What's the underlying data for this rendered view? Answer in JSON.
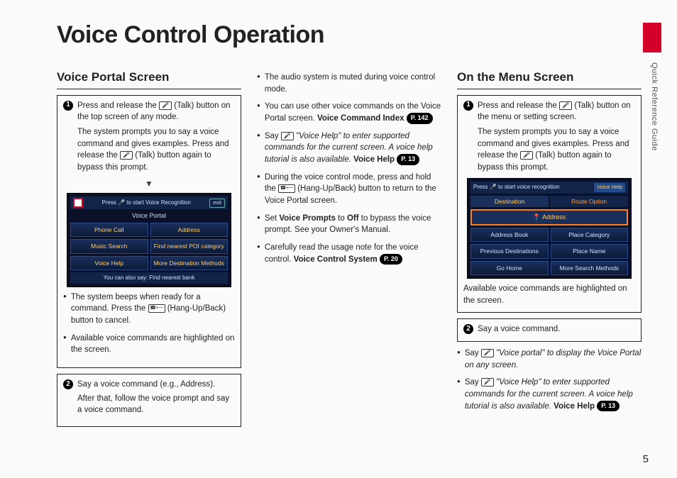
{
  "page_title": "Voice Control Operation",
  "side_label": "Quick Reference Guide",
  "page_number": "5",
  "col1": {
    "heading": "Voice Portal Screen",
    "step1a": "Press and release the ",
    "step1b": " (Talk) button on the top screen of any mode.",
    "step1c": "The system prompts you to say a voice command and gives examples. Press and release the ",
    "step1d": " (Talk) button again to bypass this prompt.",
    "bullet_a1": "The system beeps when ready for a command. Press the ",
    "bullet_a2": " (Hang-Up/Back) button to cancel.",
    "bullet_b": "Available voice commands are highlighted on the screen.",
    "step2a": "Say a voice command (e.g., Address).",
    "step2b": "After that, follow the voice prompt and say a voice command."
  },
  "mock1": {
    "bar_text": "Press 🎤 to start Voice Recognition",
    "exit": "exit",
    "title": "Voice Portal",
    "buttons": [
      "Phone Call",
      "Address",
      "Music Search",
      "Find nearest POI category",
      "Voice Help",
      "More Destination Methods"
    ],
    "footer": "You can also say: Find nearest bank"
  },
  "col2": {
    "b1": "The audio system is muted during voice control mode.",
    "b2a": "You can use other voice commands on the Voice Portal screen. ",
    "b2b": "Voice Command Index",
    "p2": "P. 142",
    "b3a": "Say ",
    "b3b": " \"Voice Help\" to enter supported commands for the current screen. A voice help tutorial is also available. ",
    "b3c": "Voice Help",
    "p3": "P. 13",
    "b4a": "During the voice control mode, press and hold the ",
    "b4b": " (Hang-Up/Back) button to return to the Voice Portal screen.",
    "b5a": "Set ",
    "b5b": "Voice Prompts",
    "b5c": " to ",
    "b5d": "Off",
    "b5e": " to bypass the voice prompt. See your Owner's Manual.",
    "b6a": "Carefully read the usage note for the voice control. ",
    "b6b": "Voice Control System",
    "p6": "P. 20"
  },
  "col3": {
    "heading": "On the Menu Screen",
    "step1a": "Press and release the ",
    "step1b": " (Talk) button on the menu or setting screen.",
    "step1c": "The system prompts you to say a voice command and gives examples. Press and release the ",
    "step1d": " (Talk) button again to bypass this prompt.",
    "caption": "Available voice commands are highlighted on the screen.",
    "step2": "Say a voice command.",
    "bullet_a1": "Say ",
    "bullet_a2": " \"Voice portal\" to display the Voice Portal on any screen.",
    "bullet_b1": "Say ",
    "bullet_b2": " \"Voice Help\" to enter supported commands for the current screen. A voice help tutorial is also available. ",
    "bullet_b3": "Voice Help",
    "pb": "P. 13"
  },
  "mock2": {
    "bar_text": "Press 🎤 to start voice recognition",
    "vh": "Voice Help",
    "tab1": "Destination",
    "tab2": "Route Option",
    "addr": "Address",
    "buttons": [
      "Address Book",
      "Place Category",
      "Previous Destinations",
      "Place Name",
      "Go Home",
      "More Search Methods"
    ]
  },
  "icons": {
    "talk": "🎤",
    "hang": "☎⟵"
  }
}
